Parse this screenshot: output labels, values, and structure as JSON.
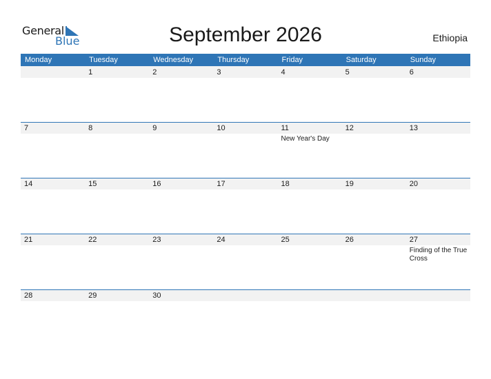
{
  "logo": {
    "word1": "General",
    "word2": "Blue",
    "icon": "triangle-flag-icon"
  },
  "title": "September 2026",
  "country": "Ethiopia",
  "colors": {
    "accent": "#2e75b6",
    "strip": "#f2f2f2"
  },
  "weekdays": [
    "Monday",
    "Tuesday",
    "Wednesday",
    "Thursday",
    "Friday",
    "Saturday",
    "Sunday"
  ],
  "weeks": [
    [
      {
        "day": "",
        "event": ""
      },
      {
        "day": "1",
        "event": ""
      },
      {
        "day": "2",
        "event": ""
      },
      {
        "day": "3",
        "event": ""
      },
      {
        "day": "4",
        "event": ""
      },
      {
        "day": "5",
        "event": ""
      },
      {
        "day": "6",
        "event": ""
      }
    ],
    [
      {
        "day": "7",
        "event": ""
      },
      {
        "day": "8",
        "event": ""
      },
      {
        "day": "9",
        "event": ""
      },
      {
        "day": "10",
        "event": ""
      },
      {
        "day": "11",
        "event": "New Year's Day"
      },
      {
        "day": "12",
        "event": ""
      },
      {
        "day": "13",
        "event": ""
      }
    ],
    [
      {
        "day": "14",
        "event": ""
      },
      {
        "day": "15",
        "event": ""
      },
      {
        "day": "16",
        "event": ""
      },
      {
        "day": "17",
        "event": ""
      },
      {
        "day": "18",
        "event": ""
      },
      {
        "day": "19",
        "event": ""
      },
      {
        "day": "20",
        "event": ""
      }
    ],
    [
      {
        "day": "21",
        "event": ""
      },
      {
        "day": "22",
        "event": ""
      },
      {
        "day": "23",
        "event": ""
      },
      {
        "day": "24",
        "event": ""
      },
      {
        "day": "25",
        "event": ""
      },
      {
        "day": "26",
        "event": ""
      },
      {
        "day": "27",
        "event": "Finding of the True Cross"
      }
    ],
    [
      {
        "day": "28",
        "event": ""
      },
      {
        "day": "29",
        "event": ""
      },
      {
        "day": "30",
        "event": ""
      },
      {
        "day": "",
        "event": ""
      },
      {
        "day": "",
        "event": ""
      },
      {
        "day": "",
        "event": ""
      },
      {
        "day": "",
        "event": ""
      }
    ]
  ]
}
